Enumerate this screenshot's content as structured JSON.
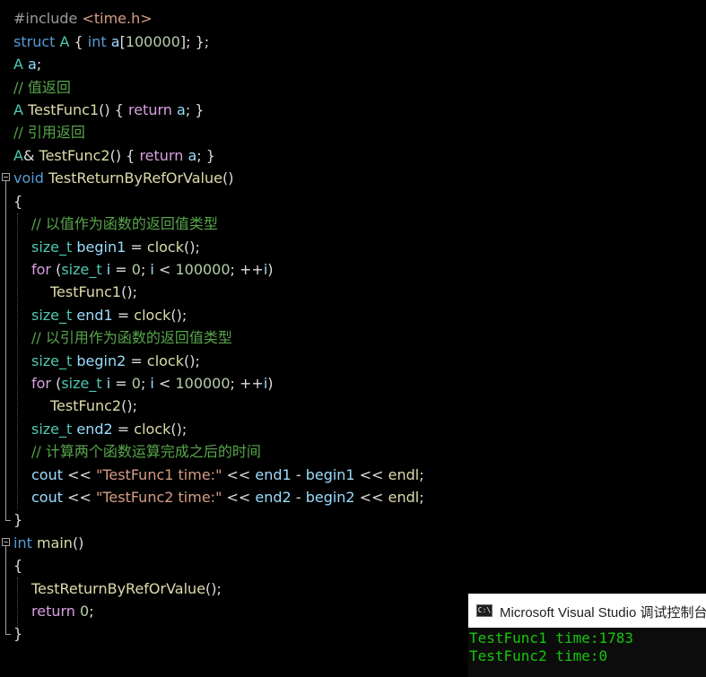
{
  "code": {
    "l1": {
      "a": "#include ",
      "b": "<time.h>"
    },
    "l2": {
      "a": "struct ",
      "b": "A",
      "c": " { ",
      "d": "int",
      "e": " ",
      "f": "a",
      "g": "[",
      "h": "100000",
      "i": "]; };"
    },
    "l3": {
      "a": "A",
      "b": " ",
      "c": "a",
      ";": ";"
    },
    "l4": "// 值返回",
    "l5": {
      "a": "A",
      "b": " ",
      "c": "TestFunc1",
      "d": "() { ",
      "e": "return",
      "f": " ",
      "g": "a",
      "h": "; }"
    },
    "l6": "// 引用返回",
    "l7": {
      "a": "A",
      "b": "& ",
      "c": "TestFunc2",
      "d": "() { ",
      "e": "return",
      "f": " ",
      "g": "a",
      "h": "; }"
    },
    "l8": {
      "a": "void",
      "b": " ",
      "c": "TestReturnByRefOrValue",
      "d": "()"
    },
    "l9": "{",
    "l10": "// 以值作为函数的返回值类型",
    "l11": {
      "a": "size_t",
      "b": " ",
      "c": "begin1",
      "d": " = ",
      "e": "clock",
      "f": "();"
    },
    "l12": {
      "a": "for",
      "b": " (",
      "c": "size_t",
      "d": " ",
      "e": "i",
      "f": " = ",
      "g": "0",
      "h": "; ",
      "i": "i",
      "j": " < ",
      "k": "100000",
      "l": "; ++",
      "m": "i",
      "n": ")"
    },
    "l13": {
      "a": "TestFunc1",
      "b": "();"
    },
    "l14": {
      "a": "size_t",
      "b": " ",
      "c": "end1",
      "d": " = ",
      "e": "clock",
      "f": "();"
    },
    "l15": "// 以引用作为函数的返回值类型",
    "l16": {
      "a": "size_t",
      "b": " ",
      "c": "begin2",
      "d": " = ",
      "e": "clock",
      "f": "();"
    },
    "l17": {
      "a": "for",
      "b": " (",
      "c": "size_t",
      "d": " ",
      "e": "i",
      "f": " = ",
      "g": "0",
      "h": "; ",
      "i": "i",
      "j": " < ",
      "k": "100000",
      "l": "; ++",
      "m": "i",
      "n": ")"
    },
    "l18": {
      "a": "TestFunc2",
      "b": "();"
    },
    "l19": {
      "a": "size_t",
      "b": " ",
      "c": "end2",
      "d": " = ",
      "e": "clock",
      "f": "();"
    },
    "l20": "// 计算两个函数运算完成之后的时间",
    "l21": {
      "a": "cout",
      "b": " << ",
      "c": "\"TestFunc1 time:\"",
      "d": " << ",
      "e": "end1",
      "f": " - ",
      "g": "begin1",
      "h": " << ",
      "i": "endl",
      "j": ";"
    },
    "l22": {
      "a": "cout",
      "b": " << ",
      "c": "\"TestFunc2 time:\"",
      "d": " << ",
      "e": "end2",
      "f": " - ",
      "g": "begin2",
      "h": " << ",
      "i": "endl",
      "j": ";"
    },
    "l23": "}",
    "l24": {
      "a": "int",
      "b": " ",
      "c": "main",
      "d": "()"
    },
    "l25": "{",
    "l26": {
      "a": "TestReturnByRefOrValue",
      "b": "();"
    },
    "l27": {
      "a": "return",
      "b": " ",
      "c": "0",
      "d": ";"
    },
    "l28": "}"
  },
  "console": {
    "icon": "C:\\",
    "title": "Microsoft Visual Studio 调试控制台",
    "output": [
      "TestFunc1 time:1783",
      "TestFunc2 time:0"
    ]
  },
  "colors": {
    "background": "#000000",
    "keyword": "#569cd6",
    "control": "#d8a0df",
    "type": "#4ec9b0",
    "function": "#dcdcaa",
    "variable": "#9cdcfe",
    "number": "#b5cea8",
    "string": "#d69d85",
    "comment": "#57a64a",
    "console_text": "#16c60c"
  }
}
